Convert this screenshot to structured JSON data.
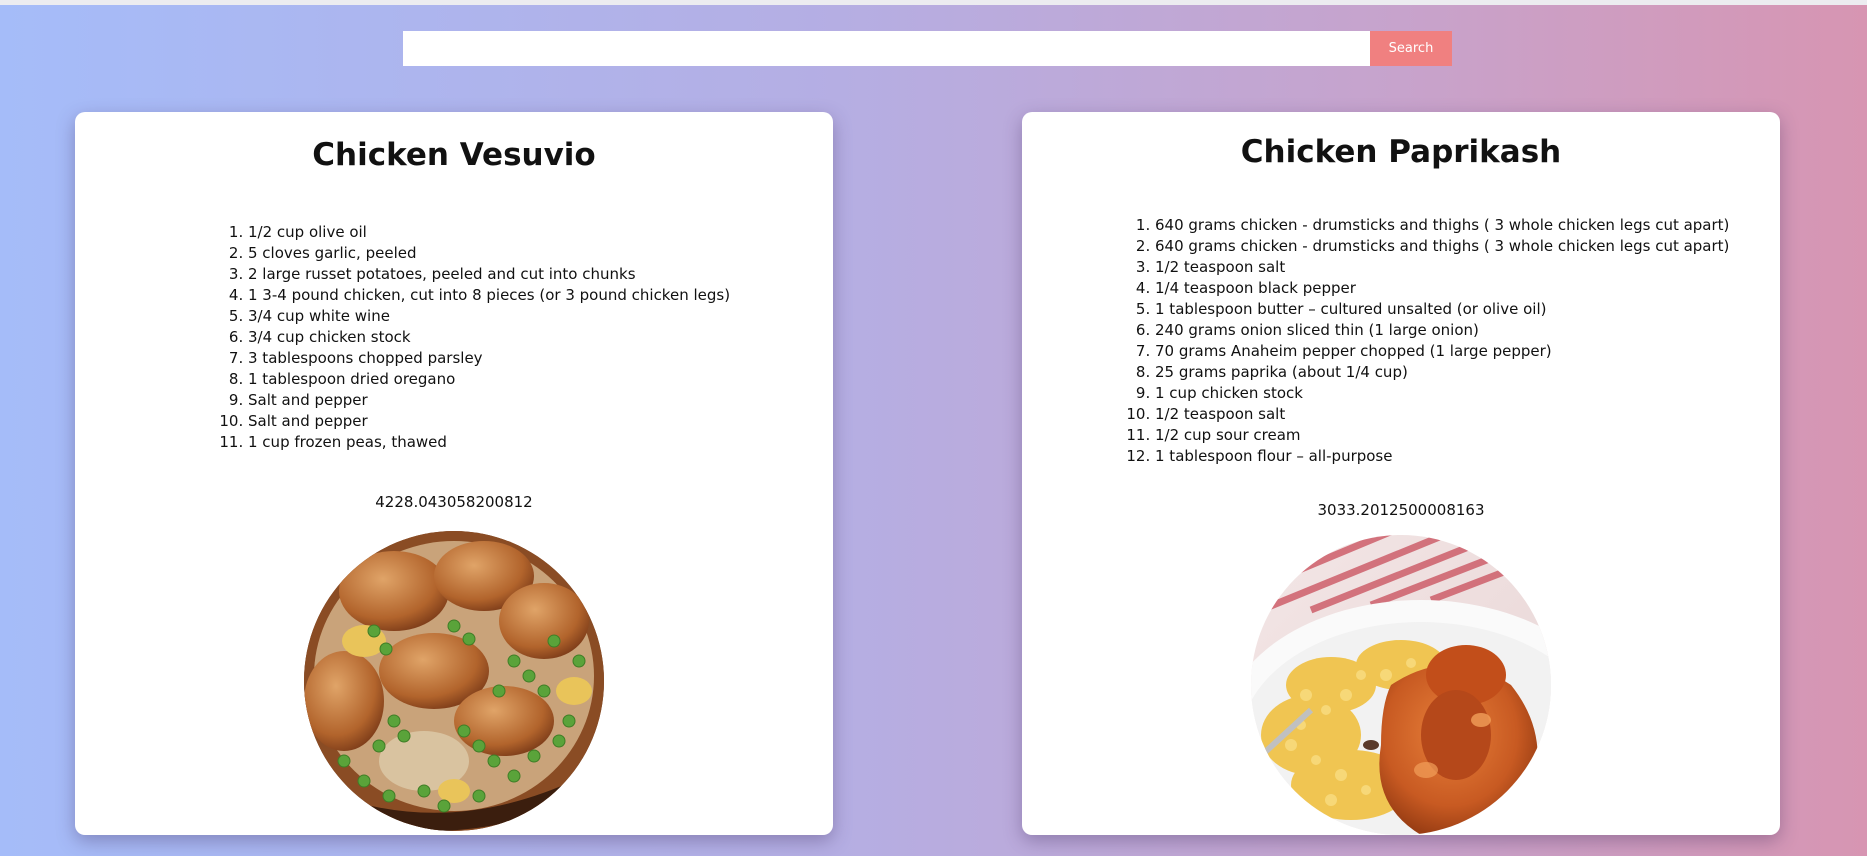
{
  "search": {
    "placeholder": "",
    "value": "",
    "button_label": "Search"
  },
  "colors": {
    "search_button": "#f08080",
    "background_start": "#a5bcf9",
    "background_end": "#d795b2",
    "card": "#ffffff"
  },
  "recipes": [
    {
      "title": "Chicken Vesuvio",
      "ingredients": [
        "1/2 cup olive oil",
        "5 cloves garlic, peeled",
        "2 large russet potatoes, peeled and cut into chunks",
        "1 3-4 pound chicken, cut into 8 pieces (or 3 pound chicken legs)",
        "3/4 cup white wine",
        "3/4 cup chicken stock",
        "3 tablespoons chopped parsley",
        "1 tablespoon dried oregano",
        "Salt and pepper",
        "Salt and pepper",
        "1 cup frozen peas, thawed"
      ],
      "value": "4228.043058200812",
      "image": "chicken-vesuvio-dish-photo"
    },
    {
      "title": "Chicken Paprikash",
      "ingredients": [
        "640 grams chicken - drumsticks and thighs ( 3 whole chicken legs cut apart)",
        "640 grams chicken - drumsticks and thighs ( 3 whole chicken legs cut apart)",
        "1/2 teaspoon salt",
        "1/4 teaspoon black pepper",
        "1 tablespoon butter – cultured unsalted (or olive oil)",
        "240 grams onion sliced thin (1 large onion)",
        "70 grams Anaheim pepper chopped (1 large pepper)",
        "25 grams paprika (about 1/4 cup)",
        "1 cup chicken stock",
        "1/2 teaspoon salt",
        "1/2 cup sour cream",
        "1 tablespoon flour – all-purpose"
      ],
      "value": "3033.2012500008163",
      "image": "chicken-paprikash-dish-photo"
    }
  ]
}
